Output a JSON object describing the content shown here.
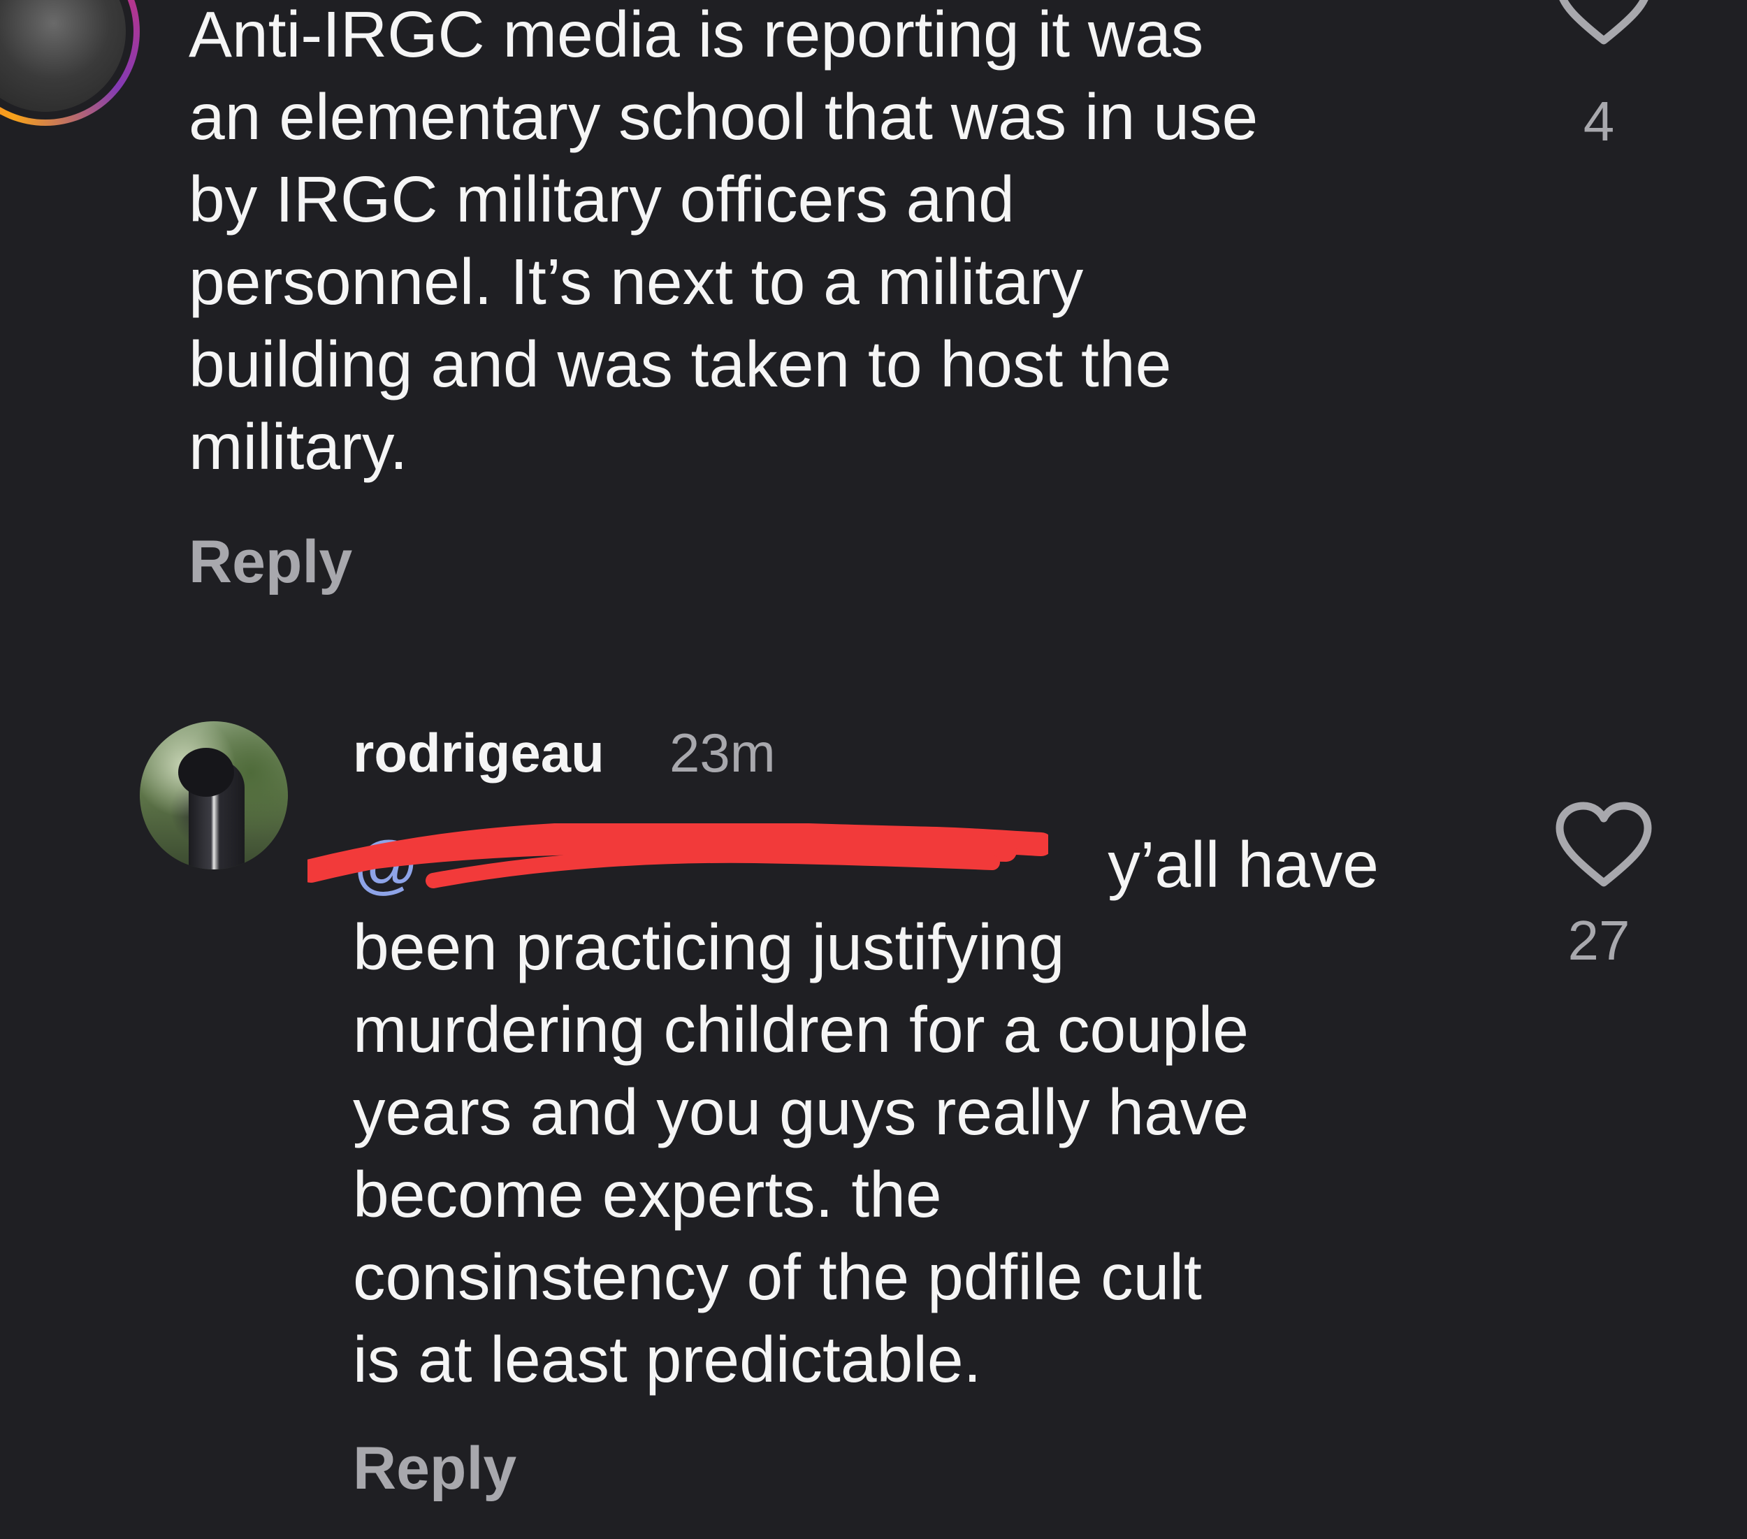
{
  "comments": [
    {
      "username": "",
      "timestamp": "",
      "mention": "",
      "body": "Anti-IRGC media is reporting it was\nan elementary school that was in use\nby IRGC military officers and\npersonnel. It’s next to a military\nbuilding and was taken to host the\nmilitary.",
      "reply_label": "Reply",
      "likes": "4",
      "heart_icon": "heart-outline-icon"
    },
    {
      "username": "rodrigeau",
      "timestamp": "23m",
      "mention": "@",
      "body": " y’all have\nbeen practicing justifying\nmurdering children for a couple\nyears and you guys really have\nbecome experts. the\nconsinstency of the pdfile cult\nis at least predictable.",
      "reply_label": "Reply",
      "likes": "27",
      "heart_icon": "heart-outline-icon"
    }
  ],
  "colors": {
    "background": "#1f1f23",
    "text": "#f5f5f5",
    "muted": "#a8a8ad",
    "mention": "#8ea4e8",
    "redaction": "#f23a3a"
  }
}
